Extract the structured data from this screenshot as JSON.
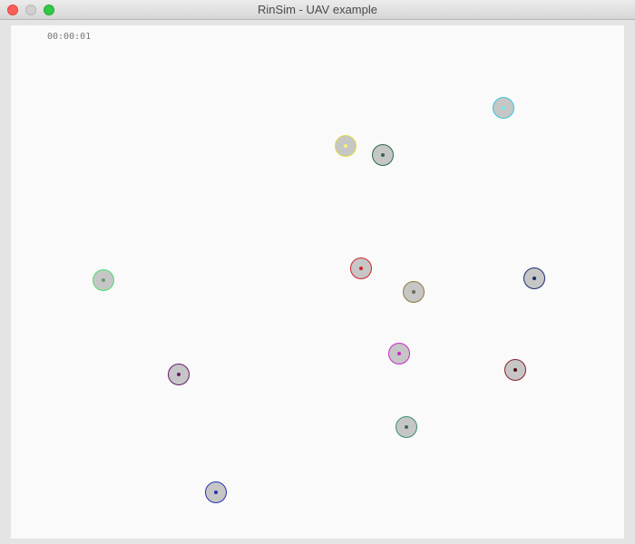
{
  "window": {
    "title": "RinSim - UAV example"
  },
  "canvas": {
    "clock": "00:00:01"
  },
  "uavs": [
    {
      "id": "cyan",
      "color": "#33c9d6",
      "dot": "#7ee6ee"
    },
    {
      "id": "yellow",
      "color": "#e1d93a",
      "dot": "#f6f07a"
    },
    {
      "id": "darkgreen",
      "color": "#2d6a45",
      "dot": "#2d6a45"
    },
    {
      "id": "lightgreen",
      "color": "#4be06a",
      "dot": "#6a9a72"
    },
    {
      "id": "red",
      "color": "#d0202a",
      "dot": "#d0202a"
    },
    {
      "id": "olive",
      "color": "#8b7a3a",
      "dot": "#6d6a5a"
    },
    {
      "id": "navy",
      "color": "#1b2a6e",
      "dot": "#1b2a6e"
    },
    {
      "id": "purple",
      "color": "#6a1a6e",
      "dot": "#6a1a6e"
    },
    {
      "id": "magenta",
      "color": "#c82ac8",
      "dot": "#c82ac8"
    },
    {
      "id": "maroon",
      "color": "#8a1f2a",
      "dot": "#4a1016"
    },
    {
      "id": "teal",
      "color": "#3a8e7a",
      "dot": "#3a6a5e"
    },
    {
      "id": "blue",
      "color": "#2333b0",
      "dot": "#2333b0"
    }
  ]
}
